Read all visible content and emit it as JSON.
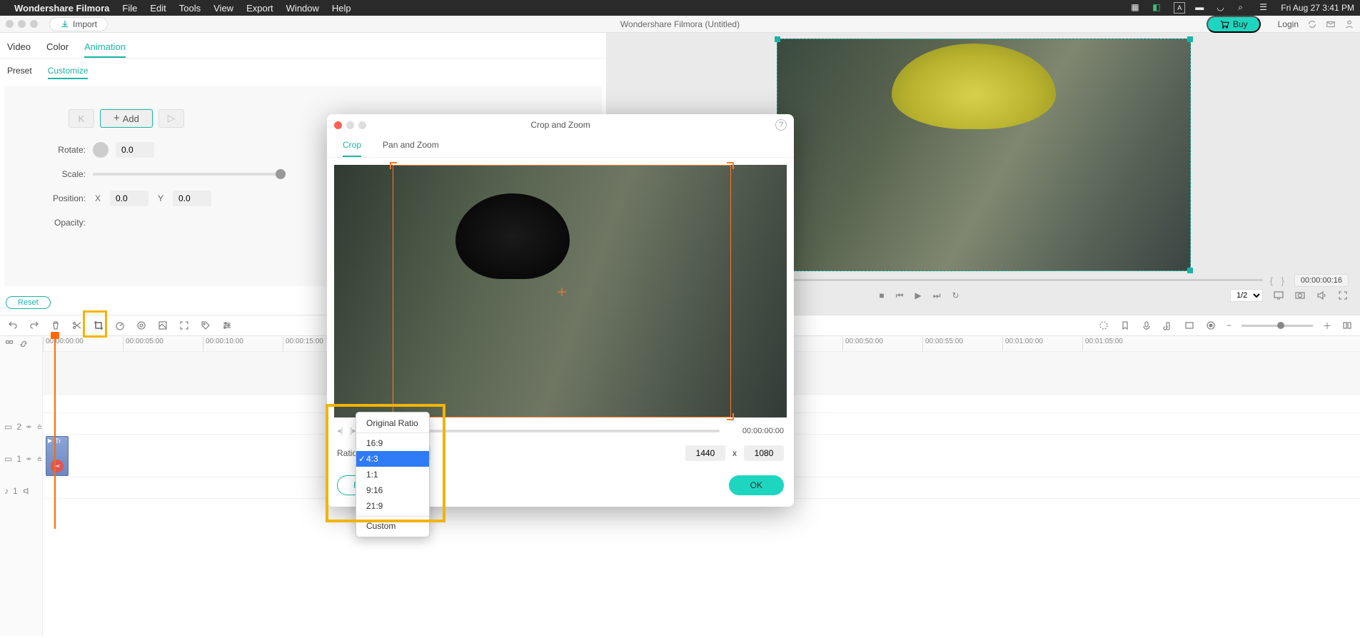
{
  "menubar": {
    "app": "Wondershare Filmora",
    "items": [
      "File",
      "Edit",
      "Tools",
      "View",
      "Export",
      "Window",
      "Help"
    ],
    "clock": "Fri Aug 27  3:41 PM"
  },
  "titlebar": {
    "import": "Import",
    "doc": "Wondershare Filmora (Untitled)",
    "buy": "Buy",
    "login": "Login"
  },
  "prop": {
    "tabs": [
      "Video",
      "Color",
      "Animation"
    ],
    "subtabs": [
      "Preset",
      "Customize"
    ],
    "add": "Add",
    "rotate_label": "Rotate:",
    "rotate_val": "0.0",
    "scale_label": "Scale:",
    "pos_label": "Position:",
    "x": "X",
    "y": "Y",
    "pos_x": "0.0",
    "pos_y": "0.0",
    "opacity_label": "Opacity:",
    "reset": "Reset"
  },
  "preview": {
    "time": "00:00:00:16",
    "speed": "1/2"
  },
  "ruler": [
    "00:00:00:00",
    "00:00:05:00",
    "00:00:10:00",
    "00:00:15:00",
    "",
    "",
    "",
    "",
    "",
    "",
    "00:00:50:00",
    "00:00:55:00",
    "00:01:00:00",
    "00:01:05:00"
  ],
  "track_head": {
    "clip_label": "Tr"
  },
  "modal": {
    "title": "Crop and Zoom",
    "tabs": [
      "Crop",
      "Pan and Zoom"
    ],
    "time": "00:00:00:00",
    "ratio_label": "Ratio:",
    "width": "1440",
    "by": "x",
    "height": "1080",
    "ok": "OK",
    "reset": "R"
  },
  "ratio_menu": {
    "items": [
      "Original Ratio",
      "16:9",
      "4:3",
      "1:1",
      "9:16",
      "21:9",
      "Custom"
    ],
    "selected_index": 2
  },
  "track_labels": {
    "t2": "2",
    "t1": "1",
    "a1": "1"
  }
}
